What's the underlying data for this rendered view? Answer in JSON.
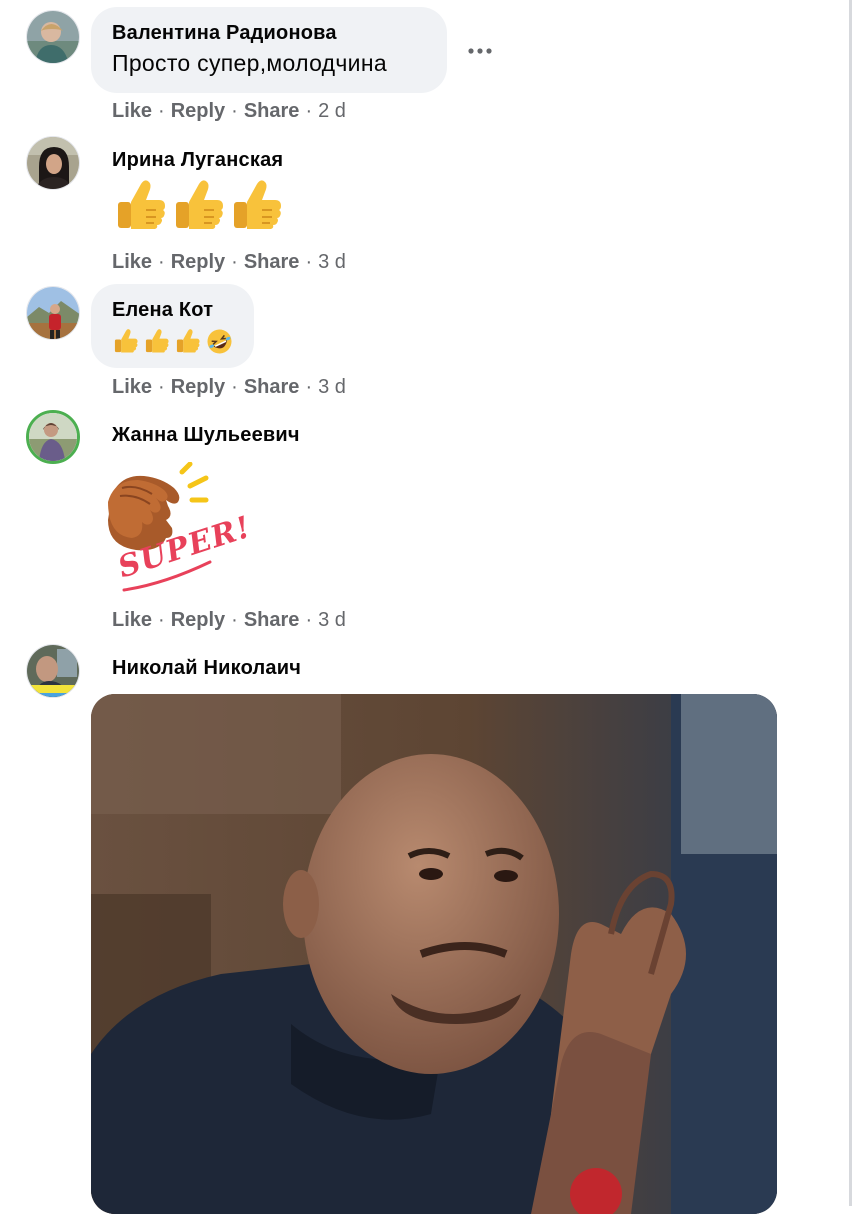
{
  "actions": {
    "like": "Like",
    "reply": "Reply",
    "share": "Share",
    "separator": "·"
  },
  "comments": [
    {
      "author": "Валентина Радионова",
      "text": "Просто супер,молодчина",
      "time": "2 d",
      "more_icon": "more-horizontal-icon"
    },
    {
      "author": "Ирина Луганская",
      "content": [
        "thumbs-up-emoji",
        "thumbs-up-emoji",
        "thumbs-up-emoji"
      ],
      "time": "3 d"
    },
    {
      "author": "Елена Кот",
      "content": [
        "thumbs-up-emoji",
        "thumbs-up-emoji",
        "thumbs-up-emoji",
        "rolling-laughing-emoji"
      ],
      "time": "3 d"
    },
    {
      "author": "Жанна Шульеевич",
      "sticker": "super-clapping-hands-sticker",
      "sticker_text": "SUPER!",
      "time": "3 d"
    },
    {
      "author": "Николай Николаич",
      "gif": "man-clapping-hands-gif"
    }
  ],
  "colors": {
    "bubble": "#f0f2f5",
    "meta": "#65676b",
    "text": "#050505",
    "sticker_text": "#e8415a",
    "hand": "#b4622d"
  }
}
